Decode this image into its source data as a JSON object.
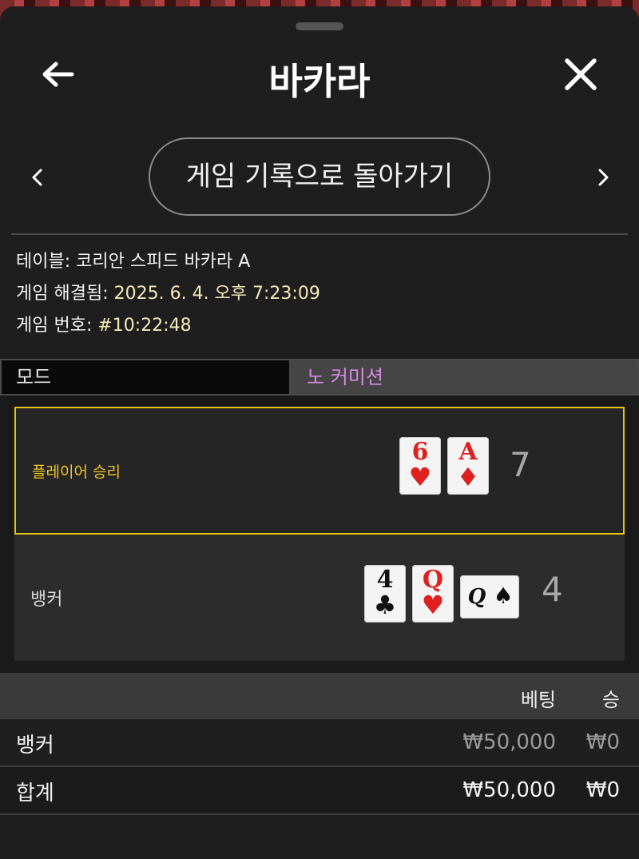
{
  "header": {
    "title": "바카라",
    "back_icon": "arrow-left-icon",
    "close_icon": "close-icon"
  },
  "nav": {
    "history_button": "게임 기록으로 돌아가기",
    "prev_icon": "chevron-left-icon",
    "next_icon": "chevron-right-icon"
  },
  "info": {
    "table_label": "테이블:",
    "table_value": "코리안 스피드 바카라 A",
    "resolved_label": "게임 해결됨:",
    "resolved_value": "2025. 6. 4. 오후 7:23:09",
    "game_no_label": "게임 번호:",
    "game_no_value": "#10:22:48"
  },
  "mode": {
    "label": "모드",
    "value": "노 커미션"
  },
  "hands": {
    "player": {
      "label": "플레이어 승리",
      "cards": [
        {
          "rank": "6",
          "suit": "♥",
          "color": "red"
        },
        {
          "rank": "A",
          "suit": "♦",
          "color": "red"
        }
      ],
      "total": "7"
    },
    "banker": {
      "label": "뱅커",
      "cards": [
        {
          "rank": "4",
          "suit": "♣",
          "color": "black"
        },
        {
          "rank": "Q",
          "suit": "♥",
          "color": "red"
        }
      ],
      "side_card": {
        "rank": "Q",
        "suit": "♠",
        "color": "black"
      },
      "total": "4"
    }
  },
  "bets": {
    "col_bet": "베팅",
    "col_win": "승",
    "rows": [
      {
        "name": "뱅커",
        "bet": "₩50,000",
        "win": "₩0"
      }
    ],
    "total": {
      "name": "합계",
      "bet": "₩50,000",
      "win": "₩0"
    }
  },
  "colors": {
    "accent_gold": "#e6c21a",
    "mode_purple": "#d98ae8",
    "card_red": "#e0201e"
  }
}
